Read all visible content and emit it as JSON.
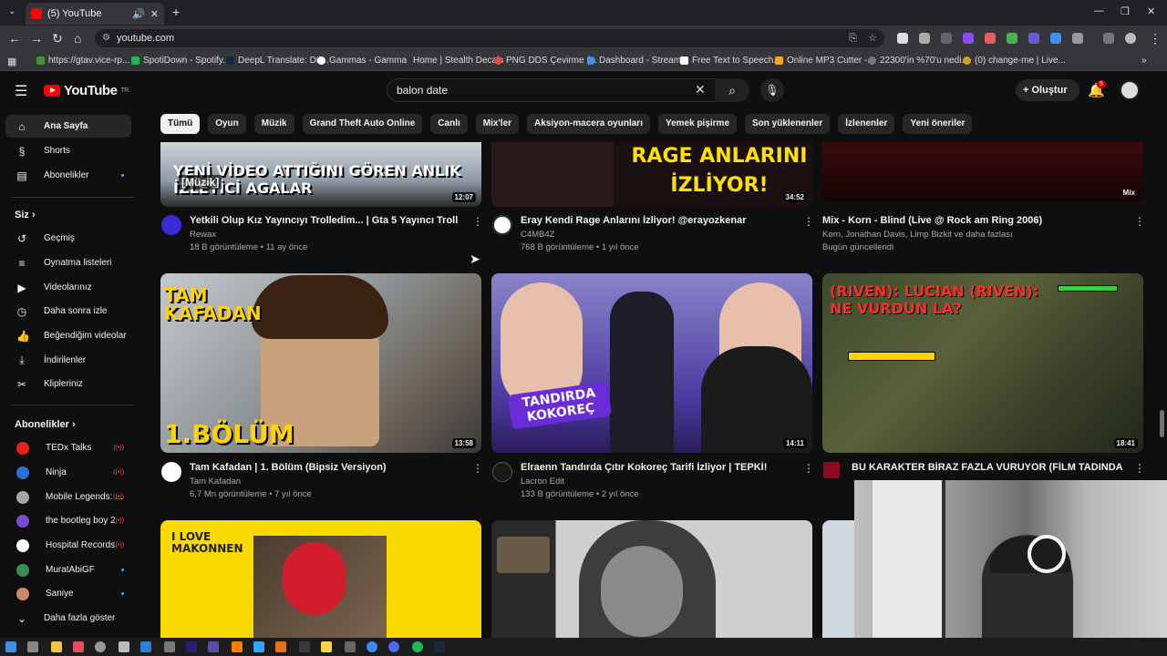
{
  "browser": {
    "tab_title": "(5) YouTube",
    "url": "youtube.com",
    "bookmarks": [
      "https://gtav.vice-rp...",
      "SpotiDown - Spotify...",
      "DeepL Translate: Dü...",
      "Gammas - Gamma",
      "Home | Stealth Decals",
      "PNG DDS Çevirme (...",
      "Dashboard - Stream...",
      "Free Text to Speech...",
      "Online MP3 Cutter -...",
      "22300'in %70'u nedi...",
      "(0) change-me | Live..."
    ]
  },
  "header": {
    "logo_text": "YouTube",
    "logo_region": "TR",
    "search_value": "balon date",
    "create_label": "Oluştur",
    "notification_count": "5"
  },
  "chips": [
    "Tümü",
    "Oyun",
    "Müzik",
    "Grand Theft Auto Online",
    "Canlı",
    "Mix'ler",
    "Aksiyon-macera oyunları",
    "Yemek pişirme",
    "Son yüklenenler",
    "İzlenenler",
    "Yeni öneriler"
  ],
  "sidebar": {
    "main": [
      {
        "label": "Ana Sayfa",
        "icon": "home-icon"
      },
      {
        "label": "Shorts",
        "icon": "shorts-icon"
      },
      {
        "label": "Abonelikler",
        "icon": "subscriptions-icon"
      }
    ],
    "you_heading": "Siz",
    "you": [
      {
        "label": "Geçmiş",
        "icon": "history-icon"
      },
      {
        "label": "Oynatma listeleri",
        "icon": "playlists-icon"
      },
      {
        "label": "Videolarınız",
        "icon": "your-videos-icon"
      },
      {
        "label": "Daha sonra izle",
        "icon": "watch-later-icon"
      },
      {
        "label": "Beğendiğim videolar",
        "icon": "liked-icon"
      },
      {
        "label": "İndirilenler",
        "icon": "downloads-icon"
      },
      {
        "label": "Klipleriniz",
        "icon": "clips-icon"
      }
    ],
    "subs_heading": "Abonelikler",
    "subs": [
      {
        "label": "TEDx Talks",
        "color": "#e62117",
        "status": "live"
      },
      {
        "label": "Ninja",
        "color": "#2e6fd8",
        "status": "live"
      },
      {
        "label": "Mobile Legends: ...",
        "color": "#a5a5a5",
        "status": "live"
      },
      {
        "label": "the bootleg boy 2",
        "color": "#7a4bd1",
        "status": "live"
      },
      {
        "label": "Hospital Records",
        "color": "#ffffff",
        "status": "live"
      },
      {
        "label": "MuratAbiGF",
        "color": "#3b8a5a",
        "status": "dot"
      },
      {
        "label": "Saniye",
        "color": "#c98a6a",
        "status": "dot"
      }
    ],
    "show_more": "Daha fazla göster"
  },
  "videos": [
    {
      "title": "Yetkili Olup Kız Yayıncıyı Trolledim... | Gta 5 Yayıncı Troll",
      "channel": "Rewax",
      "meta": "18 B görüntüleme • 11 ay önce",
      "duration": "12:07",
      "thumb_text": "YENİ VİDEO ATTIĞINI GÖREN ANLIK İZLEYİCİ AGALAR",
      "thumb_tag": "[Müzik]"
    },
    {
      "title": "Eray Kendi Rage Anlarını İzliyor! @erayozkenar",
      "channel": "C4MB4Z",
      "meta": "768 B görüntüleme • 1 yıl önce",
      "duration": "34:52",
      "thumb_text": "RAGE ANLARINI İZLİYOR!"
    },
    {
      "title": "Mix - Korn - Blind (Live @ Rock am Ring 2006)",
      "channel": "Korn, Jonathan Davis, Limp Bizkit ve daha fazlası",
      "meta": "Bugün güncellendi",
      "duration": "Mix"
    },
    {
      "title": "Tam Kafadan | 1. Bölüm (Bipsiz Versiyon)",
      "channel": "Tam Kafadan",
      "meta": "6,7 Mn görüntüleme • 7 yıl önce",
      "duration": "13:58",
      "thumb_text": "1.BÖLÜM",
      "thumb_logo": "TAM KAFADAN"
    },
    {
      "title": "Elraenn Tandırda Çıtır Kokoreç Tarifi İzliyor | TEPKİ!",
      "channel": "Lacron Edit",
      "meta": "133 B görüntüleme • 2 yıl önce",
      "duration": "14:11",
      "thumb_text": "TANDIRDA KOKOREÇ"
    },
    {
      "title": "BU KARAKTER BİRAZ FAZLA VURUYOR (FİLM TADINDA MAÇ)",
      "channel": "",
      "meta": "",
      "duration": "18:41",
      "thumb_text": "(RIVEN): LUCIAN (RIVEN): NE VURDUN LA?"
    },
    {
      "thumb_text": "I LOVE MAKONNEN"
    }
  ]
}
